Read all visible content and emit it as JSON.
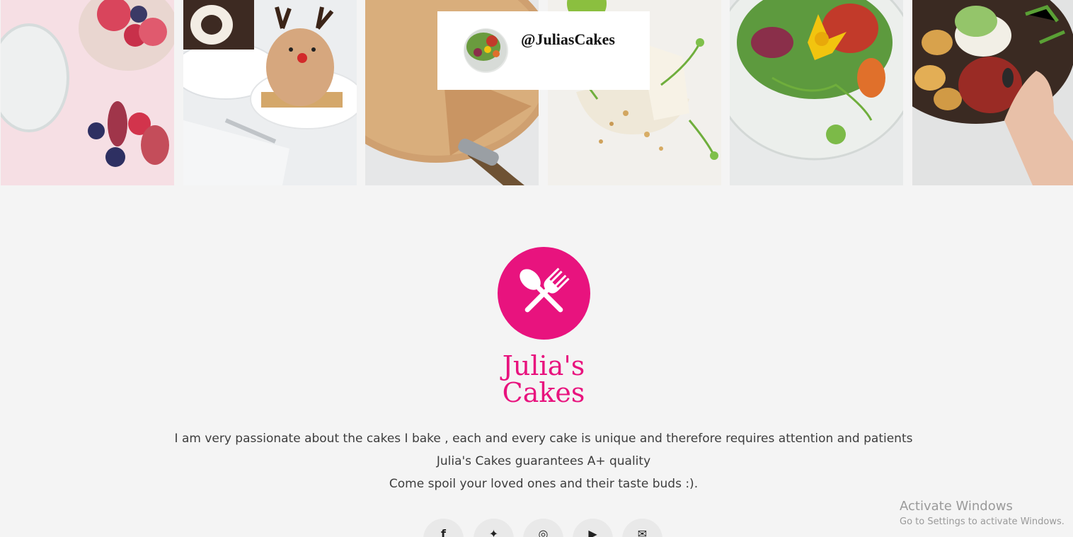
{
  "instagram": {
    "handle": "@JuliasCakes",
    "tiles": [
      {
        "name": "chia-pudding-figs-photo"
      },
      {
        "name": "reindeer-cake-photo"
      },
      {
        "name": "tart-slice-photo"
      },
      {
        "name": "garnished-dish-photo"
      },
      {
        "name": "salad-bowl-photo"
      },
      {
        "name": "loaded-potato-bowl-photo"
      }
    ]
  },
  "brand": {
    "logo_icon": "spoon-fork-cross-icon",
    "name_line1": "Julia's",
    "name_line2": "Cakes",
    "color": "#e8137e"
  },
  "about": {
    "line1": "I am very passionate about the cakes I bake , each and every cake is unique and therefore requires attention and patients",
    "line2": "Julia's Cakes guarantees A+ quality",
    "line3": "Come spoil your loved ones and their taste buds :)."
  },
  "social": [
    {
      "icon": "facebook-icon",
      "glyph": "f"
    },
    {
      "icon": "twitter-icon",
      "glyph": "✦"
    },
    {
      "icon": "instagram-icon",
      "glyph": "◎"
    },
    {
      "icon": "youtube-icon",
      "glyph": "▶"
    },
    {
      "icon": "mail-icon",
      "glyph": "✉"
    }
  ],
  "windows_watermark": {
    "title": "Activate Windows",
    "subtitle": "Go to Settings to activate Windows."
  }
}
